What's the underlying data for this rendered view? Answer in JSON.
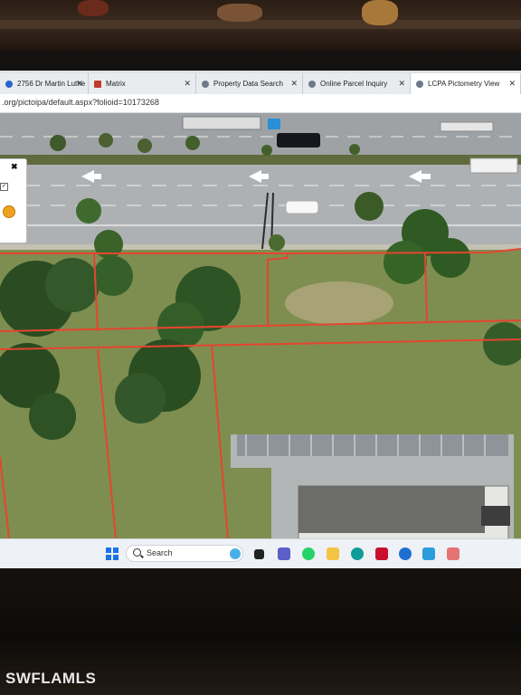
{
  "browser": {
    "tabs": [
      {
        "label": "2756 Dr Martin Luthe",
        "close": "✕",
        "favicon_color": "#2a66c9"
      },
      {
        "label": "Matrix",
        "close": "✕",
        "favicon_color": "#c0392b"
      },
      {
        "label": "Property Data Search",
        "close": "✕",
        "favicon_color": "#6c7a89"
      },
      {
        "label": "Online Parcel Inquiry",
        "close": "✕",
        "favicon_color": "#6c7a89"
      },
      {
        "label": "LCPA Pictometry View",
        "close": "✕",
        "favicon_color": "#6c7a89"
      }
    ],
    "active_tab": 4,
    "url": ".org/pictoipa/default.aspx?folioid=10173268"
  },
  "side_panel": {
    "close": "✖",
    "checkbox_mark": "✓"
  },
  "taskbar": {
    "search_label": "Search",
    "icons": [
      "windows-icon",
      "copilot-icon",
      "task-view-icon",
      "teams-icon",
      "whatsapp-icon",
      "file-explorer-icon",
      "edge-icon",
      "mcafee-icon",
      "settings-icon",
      "app-l-icon",
      "photos-icon"
    ],
    "colors": {
      "windows": "#1a73e8",
      "teams": "#5b5fc7",
      "whatsapp": "#25d366",
      "explorer": "#f4c542",
      "edge": "#0f9d9a",
      "mcafee": "#c8102e",
      "app_l": "#2d9cdb",
      "photos": "#e57373"
    }
  },
  "parcel_line_color": "#e5452f",
  "watermark": "SWFLAMLS"
}
